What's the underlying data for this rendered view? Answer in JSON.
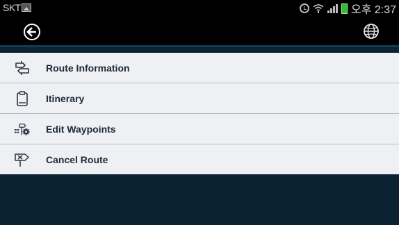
{
  "status_bar": {
    "carrier": "SKT",
    "time": "오후 2:37",
    "icons": [
      "image-notification-icon",
      "alarm-icon",
      "wifi-icon",
      "signal-icon",
      "battery-icon"
    ]
  },
  "action_bar": {
    "back_icon": "back-arrow-circle-icon",
    "globe_icon": "globe-icon"
  },
  "menu": {
    "items": [
      {
        "label": "Route Information",
        "icon": "route-signpost-icon"
      },
      {
        "label": "Itinerary",
        "icon": "clipboard-icon"
      },
      {
        "label": "Edit Waypoints",
        "icon": "waypoint-gear-icon"
      },
      {
        "label": "Cancel Route",
        "icon": "cancel-signpost-icon"
      }
    ]
  },
  "colors": {
    "status_bar_bg": "#000000",
    "menu_bg": "#eef0f4",
    "page_bg": "#0b2233",
    "divider": "#b7bcc4",
    "label_text": "#1e2a36"
  }
}
